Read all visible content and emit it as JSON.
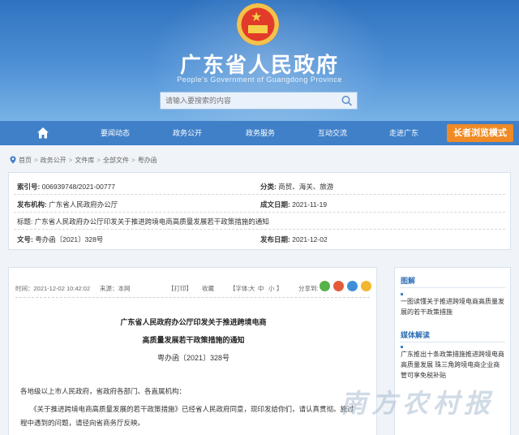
{
  "header": {
    "title": "广东省人民政府",
    "subtitle": "People's Government of Guangdong Province",
    "search_placeholder": "请输入要搜索的内容"
  },
  "nav": {
    "items": [
      "要闻动态",
      "政务公开",
      "政务服务",
      "互动交流",
      "走进广东"
    ],
    "elder_mode": "长者浏览模式"
  },
  "breadcrumb": [
    "首页",
    "政务公开",
    "文件库",
    "全部文件",
    "粤办函"
  ],
  "info": {
    "index_label": "索引号:",
    "index_value": "006939748/2021-00777",
    "category_label": "分类:",
    "category_value": "商贸、海关、旅游",
    "issuer_label": "发布机构:",
    "issuer_value": "广东省人民政府办公厅",
    "created_label": "成文日期:",
    "created_value": "2021-11-19",
    "title_label": "标题:",
    "title_value": "广东省人民政府办公厅印发关于推进跨境电商高质量发展若干政策措施的通知",
    "docno_label": "文号:",
    "docno_value": "粤办函〔2021〕328号",
    "published_label": "发布日期:",
    "published_value": "2021-12-02"
  },
  "article": {
    "time": "时间：2021-12-02 10:42:02",
    "source": "来源：本网",
    "print": "【打印】",
    "favorite": "收藏",
    "font_label": "【字体:",
    "font_large": "大",
    "font_medium": "中",
    "font_small": "小",
    "font_close": "】",
    "share_label": "分享到:",
    "heading_line1": "广东省人民政府办公厅印发关于推进跨境电商",
    "heading_line2": "高质量发展若干政策措施的通知",
    "doc_number": "粤办函〔2021〕328号",
    "salutation": "各地级以上市人民政府，省政府各部门、各直属机构：",
    "body_line1": "《关于推进跨境电商高质量发展的若干政策措施》已经省人民政府同意，现印发给你们，请认真贯彻。",
    "body_line1_tail": "施过",
    "body_line2": "程中遇到的问题，请径向省商务厅反映。"
  },
  "sidebar": {
    "section1_title": "图解",
    "section1_link": "一图读懂关于推进跨境电商高质量发展的若干政策措施",
    "section2_title": "媒体解读",
    "section2_link": "广东推出十条政策措施推进跨境电商高质量发展 珠三角跨境电商企业商管可享免税补贴"
  },
  "watermark": "南方农村报",
  "colors": {
    "header_blue": "#2f73c0",
    "nav_blue": "#3f80c9",
    "elder_orange": "#f08a24",
    "sidebar_title": "#2f6fb5"
  }
}
